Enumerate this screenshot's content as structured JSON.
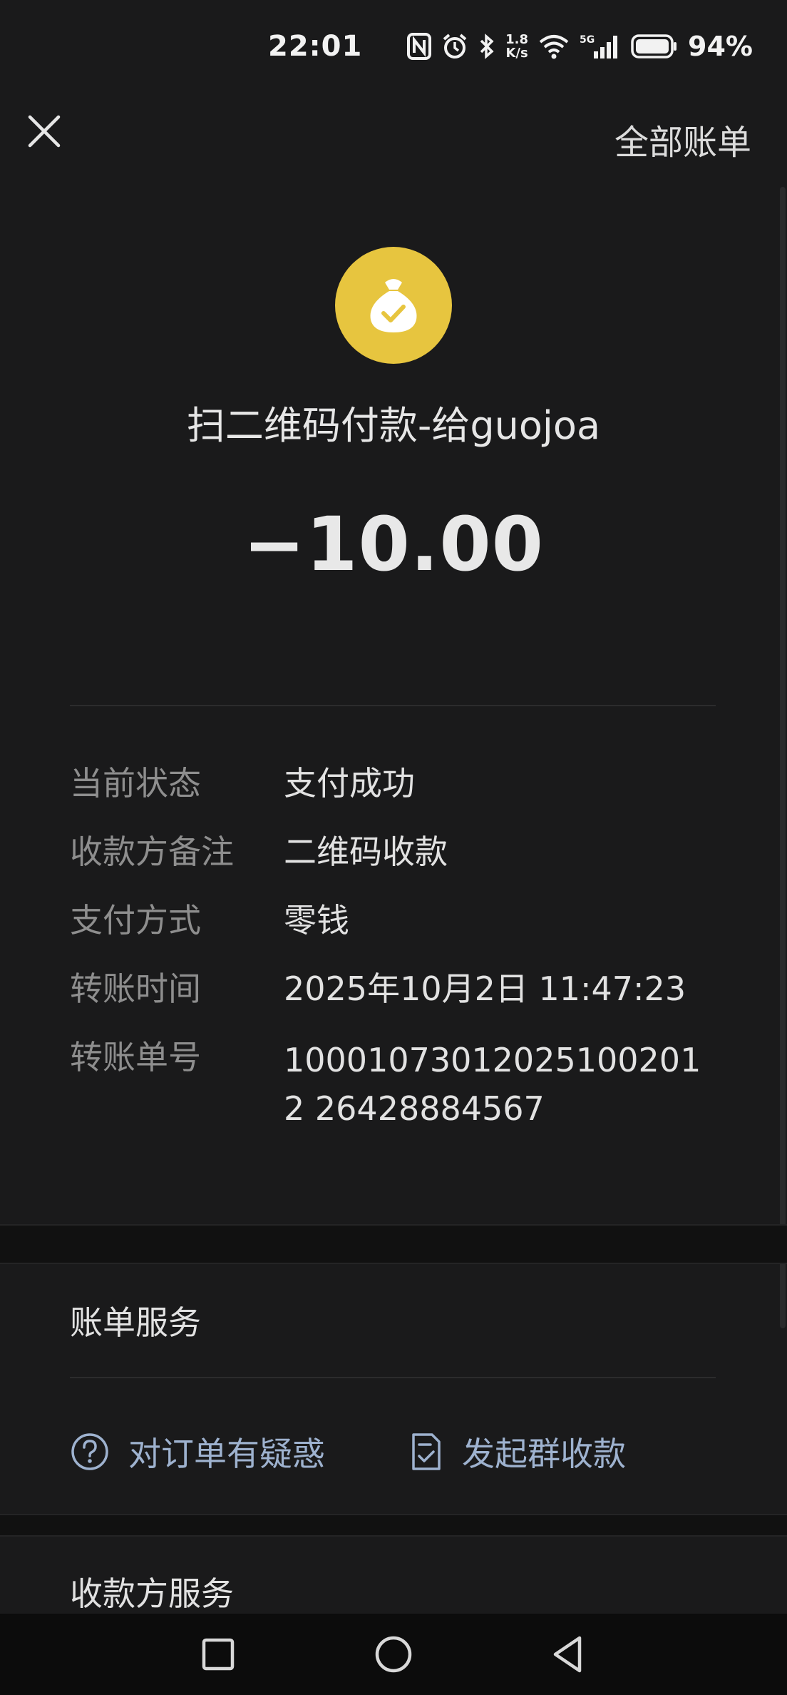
{
  "status_bar": {
    "time": "22:01",
    "net_speed_value": "1.8",
    "net_speed_unit": "K/s",
    "signal_type": "5G",
    "battery_percent": "94%",
    "icons": [
      "nfc-icon",
      "alarm-icon",
      "bluetooth-icon",
      "wifi-icon",
      "cellular-signal-icon",
      "battery-icon"
    ]
  },
  "header": {
    "close_icon": "close-icon",
    "all_bills_label": "全部账单"
  },
  "transaction": {
    "icon": "money-bag-check-icon",
    "icon_color": "#e7c53f",
    "title": "扫二维码付款-给guojoa",
    "amount": "−10.00"
  },
  "details": [
    {
      "label": "当前状态",
      "value": "支付成功"
    },
    {
      "label": "收款方备注",
      "value": "二维码收款"
    },
    {
      "label": "支付方式",
      "value": "零钱"
    },
    {
      "label": "转账时间",
      "value": "2025年10月2日 11:47:23"
    },
    {
      "label": "转账单号",
      "value": "100010730120251002012 26428884567"
    }
  ],
  "bill_services": {
    "title": "账单服务",
    "links": [
      {
        "label": "对订单有疑惑",
        "icon": "question-circle-icon"
      },
      {
        "label": "发起群收款",
        "icon": "receipt-check-icon"
      }
    ],
    "link_color": "#9eb2cf"
  },
  "payee_services": {
    "title": "收款方服务"
  },
  "nav_bar": {
    "icons": [
      "recents-square-icon",
      "home-circle-icon",
      "back-triangle-icon"
    ]
  }
}
